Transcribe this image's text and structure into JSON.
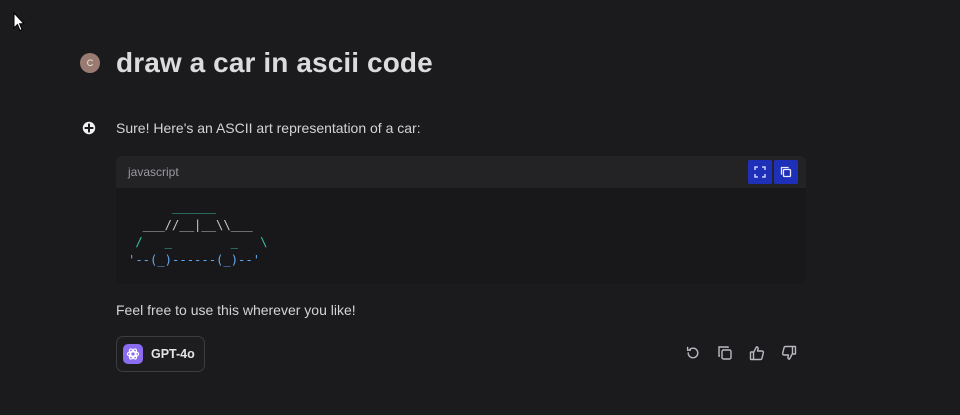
{
  "user": {
    "avatar_initial": "C",
    "prompt": "draw a car in ascii code"
  },
  "assistant": {
    "intro": "Sure! Here's an ASCII art representation of a car:",
    "code": {
      "language": "javascript",
      "lines": [
        "      ______",
        "  ___//__|__\\\\___",
        " /   _        _   \\",
        "'--(_)------(_)--'"
      ]
    },
    "outro": "Feel free to use this wherever you like!",
    "model": "GPT-4o"
  },
  "colors": {
    "background": "#1b1b1d",
    "code_button": "#1e2fb8",
    "model_logo": "#8a6cf0",
    "avatar": "#9a7b72"
  }
}
